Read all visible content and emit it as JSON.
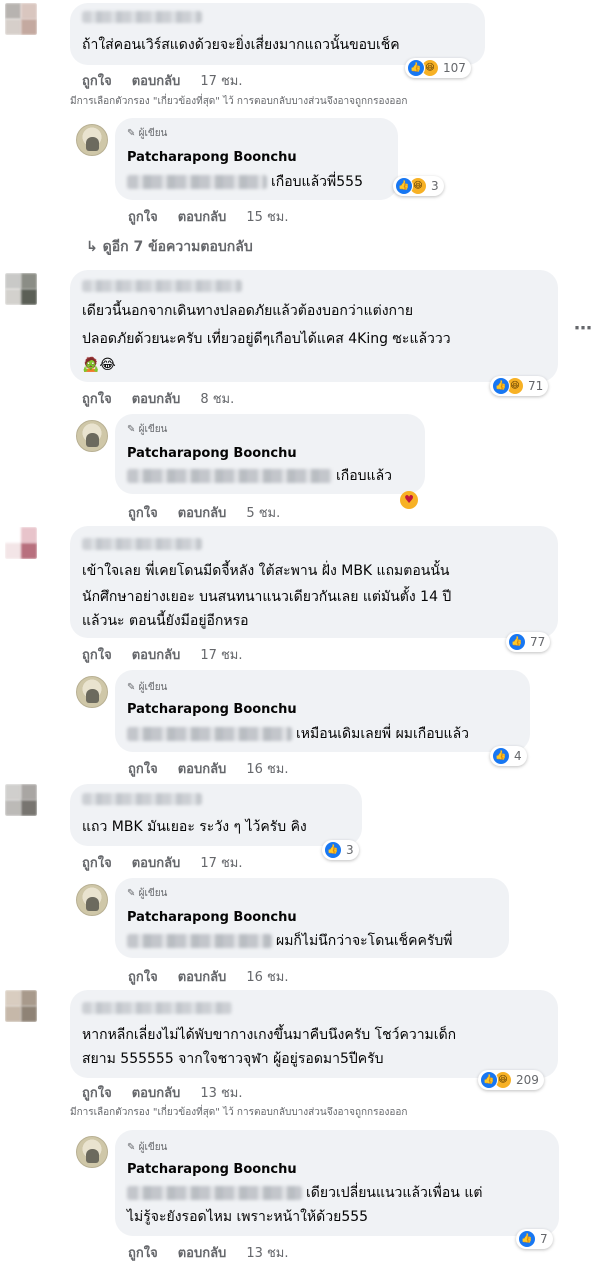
{
  "labels": {
    "like": "ถูกใจ",
    "reply": "ตอบกลับ",
    "author_tag": "ผู้เขียน",
    "author_name": "Patcharapong Boonchu"
  },
  "notice": "มีการเลือกตัวกรอง \"เกี่ยวข้องที่สุด\" ไว้ การตอบกลับบางส่วนจึงอาจถูกกรองออก",
  "more_replies": "ดูอีก 7 ข้อความตอบกลับ",
  "comments": [
    {
      "text": [
        "ถ้าใส่คอนเวิร์สแดงด้วยจะยิ่งเสี่ยงมากแถวนั้นขอบเช็ค"
      ],
      "time": "17 ชม.",
      "reactions": "107"
    },
    {
      "reply_text": [
        "เกือบแล้วพี่555"
      ],
      "time": "15 ชม.",
      "reactions": "3"
    },
    {
      "text": [
        "เดียวนี้นอกจากเดินทางปลอดภัยแล้วต้องบอกว่าแต่งกาย",
        "ปลอดภัยด้วยนะครับ เที่ยวอยู่ดีๆเกือบได้แคส 4King ซะแล้ววว",
        "🧟😂"
      ],
      "time": "8 ชม.",
      "reactions": "71"
    },
    {
      "reply_text": [
        "เกือบแล้ว"
      ],
      "time": "5 ชม."
    },
    {
      "text": [
        "เข้าใจเลย พี่เคยโดนมีดจี้หลัง ใต้สะพาน ฝั่ง MBK แถมตอนนั้น",
        "นักศึกษาอย่างเยอะ บนสนทนาแนวเดียวกันเลย แต่มันตั้ง 14 ปี",
        "แล้วนะ ตอนนี้ยังมีอยู่อีกหรอ"
      ],
      "time": "17 ชม.",
      "reactions": "77"
    },
    {
      "reply_text": [
        "เหมือนเดิมเลยพี่ ผมเกือบแล้ว"
      ],
      "time": "16 ชม.",
      "reactions": "4"
    },
    {
      "text": [
        "แถว MBK มันเยอะ ระวัง ๆ ไว้ครับ คิง"
      ],
      "time": "17 ชม.",
      "reactions": "3"
    },
    {
      "reply_text": [
        "ผมก็ไม่นึกว่าจะโดนเช็คครับพี่"
      ],
      "time": "16 ชม."
    },
    {
      "text": [
        "หากหลีกเลี่ยงไม่ได้พับขากางเกงขึ้นมาคืบนึงครับ โชว์ความเด็ก",
        "สยาม 555555 จากใจชาวจุฬา ผู้อยู่รอดมา5ปีครับ"
      ],
      "time": "13 ชม.",
      "reactions": "209"
    },
    {
      "reply_text": [
        "เดียวเปลี่ยนแนวแล้วเพื่อน แต่",
        "ไม่รู้จะยังรอดไหม เพราะหน้าให้ด้วย555"
      ],
      "time": "13 ชม.",
      "reactions": "7"
    }
  ],
  "icons": {
    "like": "like-icon",
    "haha": "haha-icon",
    "care": "care-icon",
    "pencil": "pencil-icon",
    "arrow": "reply-arrow-icon",
    "more": "more-options-icon"
  },
  "colors": {
    "like_blue": "#1877f2",
    "haha_yellow": "#f7b125",
    "bubble": "#f0f2f5",
    "meta_gray": "#65676b"
  }
}
